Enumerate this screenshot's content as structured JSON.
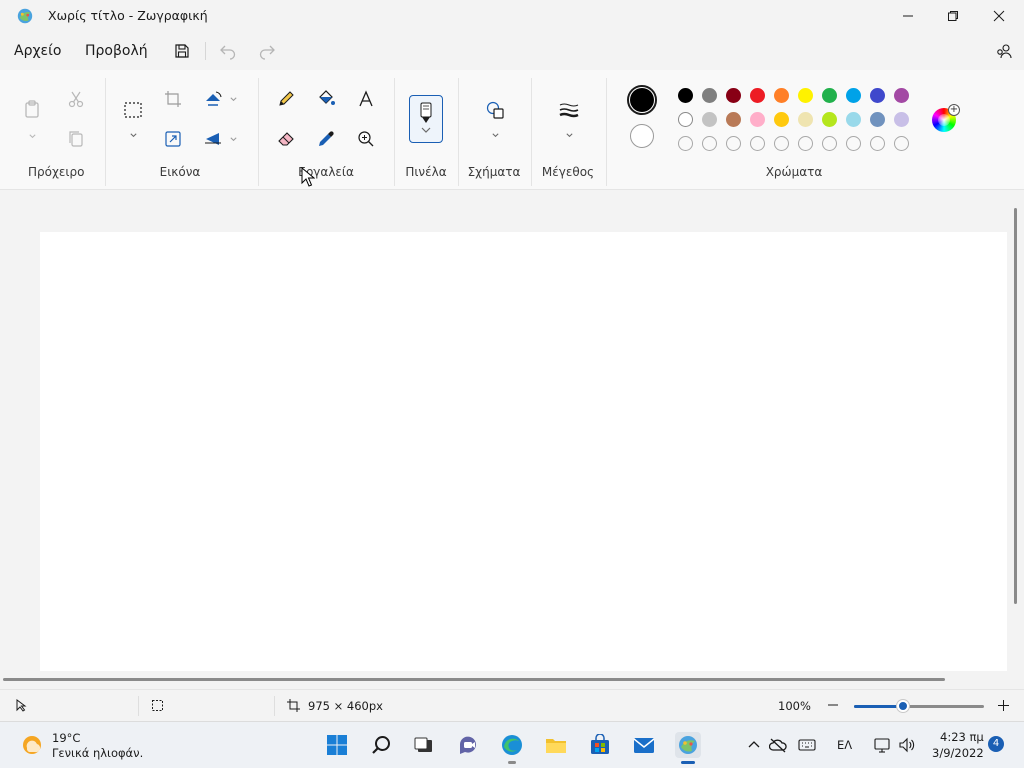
{
  "window": {
    "title": "Χωρίς τίτλο - Ζωγραφική",
    "app_icon": "paint-palette-icon"
  },
  "menu": {
    "file": "Αρχείο",
    "view": "Προβολή"
  },
  "ribbon": {
    "groups": {
      "clipboard": "Πρόχειρο",
      "image": "Εικόνα",
      "tools": "Εργαλεία",
      "brushes": "Πινέλα",
      "shapes": "Σχήματα",
      "size": "Μέγεθος",
      "colors": "Χρώματα"
    },
    "primary_color": "#000000",
    "secondary_color": "#ffffff",
    "palette_row1": [
      "#000000",
      "#7f7f7f",
      "#880015",
      "#ed1c24",
      "#ff7f27",
      "#fff200",
      "#22b14c",
      "#00a2e8",
      "#3f48cc",
      "#a349a4"
    ],
    "palette_row2": [
      "#ffffff",
      "#c3c3c3",
      "#b97a57",
      "#ffaec9",
      "#ffc90e",
      "#efe4b0",
      "#b5e61d",
      "#99d9ea",
      "#7092be",
      "#c8bfe7"
    ],
    "palette_row3_empty_count": 10
  },
  "status": {
    "canvas_size": "975 × 460px",
    "zoom": "100%",
    "zoom_level_fraction": 0.38
  },
  "taskbar": {
    "weather_temp": "19°C",
    "weather_desc": "Γενικά ηλιοφάν.",
    "language": "ΕΛ",
    "time": "4:23 πμ",
    "date": "3/9/2022",
    "notification_count": "4"
  },
  "colors": {
    "accent": "#1a5fb4"
  }
}
